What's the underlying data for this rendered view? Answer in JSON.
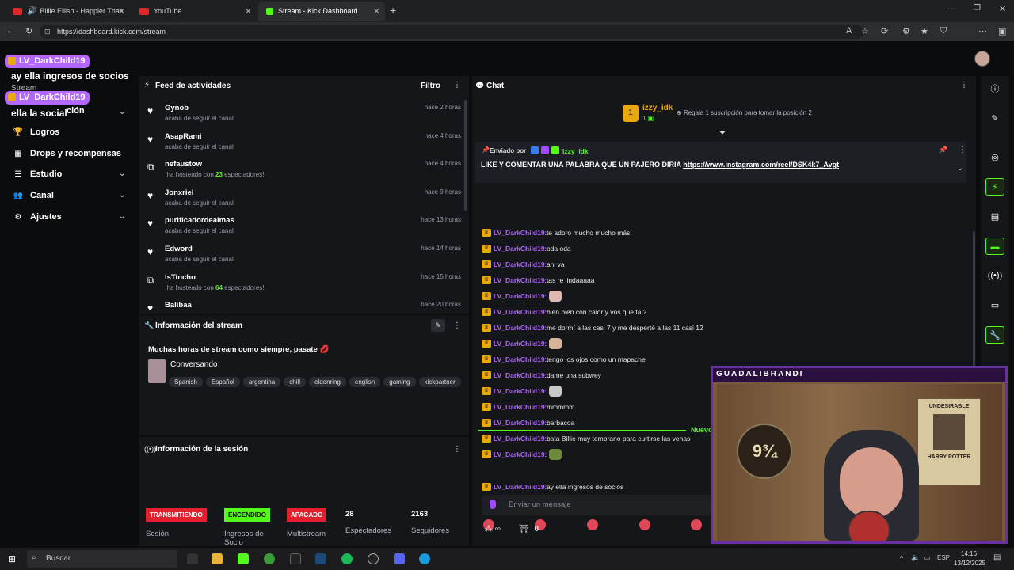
{
  "browser": {
    "tabs": [
      {
        "label": "Billie Eilish - Happier Than Ev",
        "color": "#e02828"
      },
      {
        "label": "YouTube",
        "color": "#e02828"
      },
      {
        "label": "Stream - Kick Dashboard",
        "color": "#53fc18"
      }
    ],
    "url": "https://dashboard.kick.com/stream"
  },
  "overlay": {
    "alert1_user": "LV_DarkChild19",
    "alert1_text": "ay ella ingresos de socios",
    "alert2_user": "LV_DarkChild19",
    "alert2_text": "ella la social",
    "hidden_nav_suffix": "ción",
    "hidden_nav_stream": "Stream"
  },
  "sidebar": {
    "items": [
      {
        "label": "Logros",
        "icon": "trophy-icon",
        "chevron": false
      },
      {
        "label": "Drops y recompensas",
        "icon": "gift-icon",
        "chevron": false
      },
      {
        "label": "Estudio",
        "icon": "list-icon",
        "chevron": true
      },
      {
        "label": "Canal",
        "icon": "users-icon",
        "chevron": true
      },
      {
        "label": "Ajustes",
        "icon": "gear-icon",
        "chevron": true
      }
    ]
  },
  "feed": {
    "title": "Feed de actividades",
    "filter_label": "Filtro",
    "items": [
      {
        "name": "Gynob",
        "desc": "acaba de seguir el canal",
        "time": "hace 2 horas",
        "type": "follow"
      },
      {
        "name": "AsapRami",
        "desc": "acaba de seguir el canal",
        "time": "hace 4 horas",
        "type": "follow"
      },
      {
        "name": "nefaustow",
        "desc_pre": "¡ha hosteado con ",
        "count": "23",
        "desc_post": " espectadores!",
        "time": "hace 4 horas",
        "type": "host"
      },
      {
        "name": "Jonxriel",
        "desc": "acaba de seguir el canal",
        "time": "hace 9 horas",
        "type": "follow"
      },
      {
        "name": "purificadordealmas",
        "desc": "acaba de seguir el canal",
        "time": "hace 13 horas",
        "type": "follow"
      },
      {
        "name": "Edword",
        "desc": "acaba de seguir el canal",
        "time": "hace 14 horas",
        "type": "follow"
      },
      {
        "name": "IsTincho",
        "desc_pre": "¡ha hosteado con ",
        "count": "64",
        "desc_post": " espectadores!",
        "time": "hace 15 horas",
        "type": "host"
      },
      {
        "name": "Balibaa",
        "desc": "",
        "time": "hace 20 horas",
        "type": "follow"
      }
    ]
  },
  "stream_info": {
    "title": "Información del stream",
    "stream_title": "Muchas horas de stream como siempre, pasate",
    "category": "Conversando",
    "tags": [
      "Spanish",
      "Español",
      "argentina",
      "chill",
      "eldenring",
      "english",
      "gaming",
      "kickpartner"
    ]
  },
  "session": {
    "title": "Información de la sesión",
    "badges": [
      {
        "text": "TRANSMITIENDO",
        "label": "Sesión",
        "bg": "#e5202e",
        "fg": "#ffffff"
      },
      {
        "text": "ENCENDIDO",
        "label": "Ingresos de Socio",
        "bg": "#53fc18",
        "fg": "#0b0c0e"
      },
      {
        "text": "APAGADO",
        "label": "Multistream",
        "bg": "#e5202e",
        "fg": "#ffffff"
      }
    ],
    "stats": [
      {
        "value": "28",
        "label": "Espectadores"
      },
      {
        "value": "2163",
        "label": "Seguidores"
      }
    ]
  },
  "chat": {
    "title": "Chat",
    "top_user": "izzy_idk",
    "top_rank": "1",
    "top_count": "1",
    "gift_prompt": "Regala 1 suscripción para tomar la posición 2",
    "pinned_prefix": "Enviado por",
    "pinned_user": "izzy_idk",
    "pinned_text": "LIKE Y COMENTAR UNA PALABRA QUE UN PAJERO DIRIA",
    "pinned_link": "https://www.instagram.com/reel/DSK4k7_Avgt",
    "new_label": "Nuevo",
    "messages": [
      {
        "user": "LV_DarkChild19",
        "text": "te adoro mucho mucho más"
      },
      {
        "user": "LV_DarkChild19",
        "text": "oda oda"
      },
      {
        "user": "LV_DarkChild19",
        "text": "ahi va"
      },
      {
        "user": "LV_DarkChild19",
        "text": "tas re lindaaaaa"
      },
      {
        "user": "LV_DarkChild19",
        "text": "",
        "emote": "#e0b8b0"
      },
      {
        "user": "LV_DarkChild19",
        "text": "bien bien con calor y vos que tal?"
      },
      {
        "user": "LV_DarkChild19",
        "text": "me dormí a las casi 7 y me desperté a las 11 casi 12"
      },
      {
        "user": "LV_DarkChild19",
        "text": "",
        "emote": "#d9b49a"
      },
      {
        "user": "LV_DarkChild19",
        "text": "tengo los ojos como un mapache"
      },
      {
        "user": "LV_DarkChild19",
        "text": "dame una subwey"
      },
      {
        "user": "LV_DarkChild19",
        "text": "",
        "emote": "#c8c8c8"
      },
      {
        "user": "LV_DarkChild19",
        "text": "mmmmm"
      },
      {
        "user": "LV_DarkChild19",
        "text": "barbacoa"
      },
      {
        "user": "LV_DarkChild19",
        "text": "bata Billie muy temprano para curtirse las venas"
      },
      {
        "user": "LV_DarkChild19",
        "text": "",
        "emote": "#6a8a3a"
      },
      {
        "user": "LV_DarkChild19",
        "text": "ay ella ingresos de socios"
      },
      {
        "user": "LV_DarkChild19",
        "text": "ella la social"
      }
    ],
    "input_placeholder": "Enviar un mensaje",
    "points": "0"
  },
  "webcam": {
    "name_label": "GUADALIBRANDI",
    "poster_text": "UNDESIRABLE",
    "poster_sub": "HARRY POTTER",
    "platform_text": "9¾"
  },
  "taskbar": {
    "search_placeholder": "Buscar",
    "lang": "ESP",
    "time": "14:16",
    "date": "13/12/2025"
  },
  "colors": {
    "accent": "#53fc18",
    "username": "#b066ff",
    "crown": "#e8a90f"
  }
}
